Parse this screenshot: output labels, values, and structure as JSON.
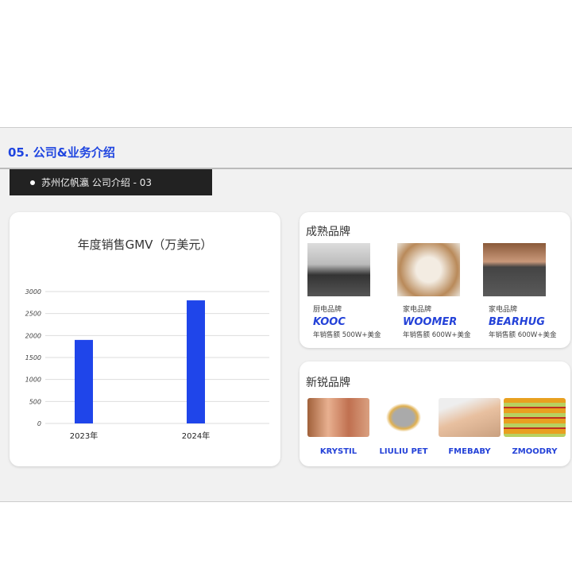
{
  "header": {
    "title": "05.  公司&业务介绍",
    "tag": "苏州亿帆瀛   公司介绍  - 03"
  },
  "chart_data": {
    "type": "bar",
    "title": "年度销售GMV（万美元）",
    "categories": [
      "2023年",
      "2024年"
    ],
    "values": [
      1900,
      2800
    ],
    "ylim": [
      0,
      3000
    ],
    "yticks": [
      0,
      500,
      1000,
      1500,
      2000,
      2500,
      3000
    ],
    "grid": true,
    "bar_color": "#1f45ea"
  },
  "mature": {
    "title": "成熟品牌",
    "items": [
      {
        "category": "厨电品牌",
        "brand": "KOOC",
        "sales": "年销售额 500W+美金"
      },
      {
        "category": "家电品牌",
        "brand": "WOOMER",
        "sales": "年销售额 600W+美金"
      },
      {
        "category": "家电品牌",
        "brand": "BEARHUG",
        "sales": "年销售额 600W+美金"
      }
    ]
  },
  "emerging": {
    "title": "新锐品牌",
    "items": [
      {
        "brand": "KRYSTIL"
      },
      {
        "brand": "LIULIU PET"
      },
      {
        "brand": "FMEBABY"
      },
      {
        "brand": "ZMOODRY"
      }
    ]
  }
}
